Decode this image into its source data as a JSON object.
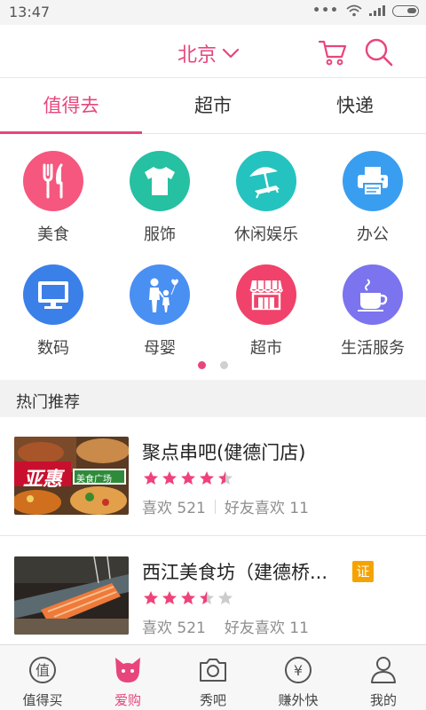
{
  "status_bar": {
    "time": "13:47",
    "dots": "•••"
  },
  "header": {
    "city": "北京",
    "accent": "#e8457d",
    "cart_icon": "cart-icon",
    "search_icon": "search-icon"
  },
  "tabs": [
    {
      "label": "值得去",
      "active": true
    },
    {
      "label": "超市",
      "active": false
    },
    {
      "label": "快递",
      "active": false
    }
  ],
  "categories": [
    {
      "label": "美食",
      "icon": "fork-knife-icon",
      "color": "#f5577e"
    },
    {
      "label": "服饰",
      "icon": "tshirt-icon",
      "color": "#26c0a2"
    },
    {
      "label": "休闲娱乐",
      "icon": "beach-umbrella-icon",
      "color": "#24c3bf"
    },
    {
      "label": "办公",
      "icon": "printer-icon",
      "color": "#3a9ef0"
    },
    {
      "label": "数码",
      "icon": "monitor-icon",
      "color": "#3a80e8"
    },
    {
      "label": "母婴",
      "icon": "parent-child-icon",
      "color": "#4a8ff2"
    },
    {
      "label": "超市",
      "icon": "storefront-icon",
      "color": "#f0426a"
    },
    {
      "label": "生活服务",
      "icon": "coffee-cup-icon",
      "color": "#7b74ee"
    }
  ],
  "pager": {
    "pages": 2,
    "current": 1
  },
  "section": {
    "title": "热门推荐"
  },
  "list": [
    {
      "title": "聚点串吧(健德门店)",
      "rating": 4.5,
      "likes": "喜欢 521",
      "friend_likes": "好友喜欢 11",
      "thumb_banner": "亚惠",
      "thumb_sign": "美食广场",
      "verified_badge": ""
    },
    {
      "title": "西江美食坊（建德桥...",
      "rating": 3.5,
      "likes": "喜欢 521",
      "friend_likes": "好友喜欢 11",
      "verified_badge": "证"
    }
  ],
  "bottom_nav": [
    {
      "label": "值得买",
      "icon": "zhi-badge-icon",
      "glyph": "值",
      "active": false
    },
    {
      "label": "爱购",
      "icon": "cat-face-icon",
      "active": true
    },
    {
      "label": "秀吧",
      "icon": "camera-icon",
      "active": false
    },
    {
      "label": "赚外快",
      "icon": "yen-coin-icon",
      "glyph": "¥",
      "active": false
    },
    {
      "label": "我的",
      "icon": "user-icon",
      "active": false
    }
  ],
  "colors": {
    "star_on": "#f0427a",
    "star_off": "#cccccc",
    "badge": "#f5a300"
  }
}
